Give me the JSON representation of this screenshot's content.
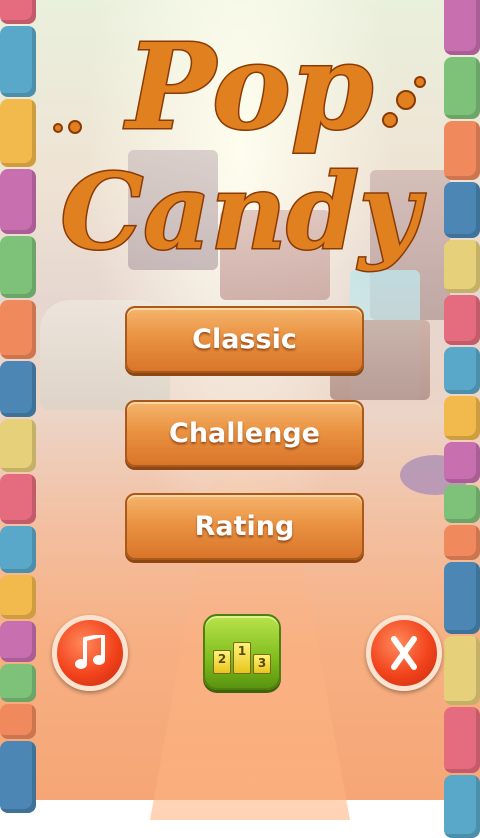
{
  "title": {
    "line1": "Pop",
    "line2": "Candy"
  },
  "menu": [
    {
      "label": "Classic"
    },
    {
      "label": "Challenge"
    },
    {
      "label": "Rating"
    }
  ],
  "podium": [
    "2",
    "1",
    "3"
  ],
  "icons": {
    "music": "music-note-icon",
    "close": "close-x-icon",
    "leaderboard": "podium-icon"
  },
  "colors": {
    "button_orange": "#ea9343",
    "round_red": "#f2431c",
    "leaderboard_green": "#7fbd1d",
    "title_caramel": "#e0801f"
  }
}
